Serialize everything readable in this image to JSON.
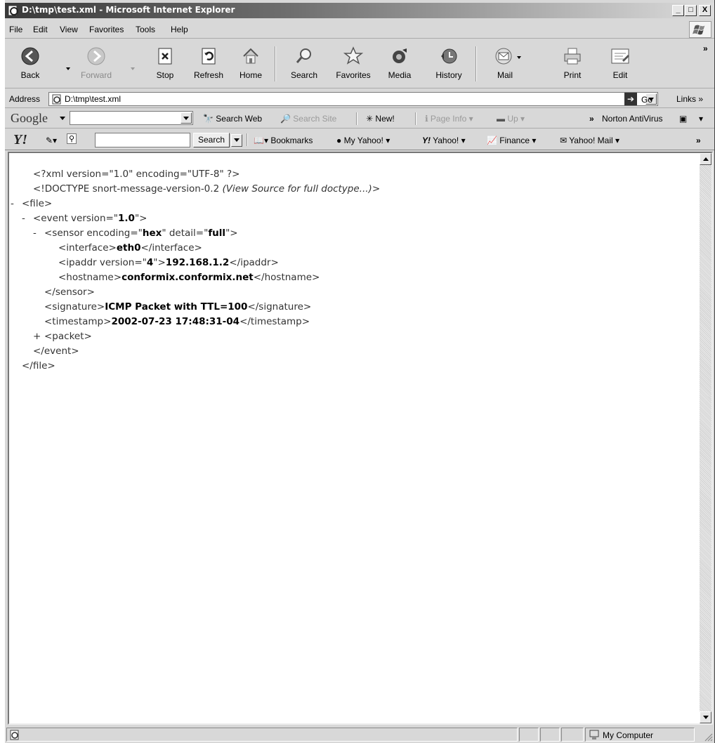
{
  "window": {
    "title": "D:\\tmp\\test.xml - Microsoft Internet Explorer",
    "minimize": "_",
    "maximize": "□",
    "close": "X"
  },
  "menubar": {
    "items": [
      "File",
      "Edit",
      "View",
      "Favorites",
      "Tools",
      "Help"
    ]
  },
  "toolbar": {
    "back": "Back",
    "forward": "Forward",
    "stop": "Stop",
    "refresh": "Refresh",
    "home": "Home",
    "search": "Search",
    "favorites": "Favorites",
    "media": "Media",
    "history": "History",
    "mail": "Mail",
    "print": "Print",
    "edit": "Edit",
    "more": "»"
  },
  "address": {
    "label": "Address",
    "value": "D:\\tmp\\test.xml",
    "go": "Go",
    "links": "Links »"
  },
  "google_bar": {
    "logo": "Google",
    "search_web": "Search Web",
    "search_site": "Search Site",
    "new": "New!",
    "page_info": "Page Info",
    "up": "Up",
    "more": "»",
    "norton": "Norton AntiVirus"
  },
  "yahoo_bar": {
    "logo": "Y!",
    "search_button": "Search",
    "bookmarks": "Bookmarks",
    "my_yahoo": "My Yahoo!",
    "yahoo": "Yahoo!",
    "finance": "Finance",
    "yahoo_mail": "Yahoo! Mail",
    "more": "»"
  },
  "xml": {
    "l1": "<?xml version=\"1.0\" encoding=\"UTF-8\" ?>",
    "l2_a": "<!DOCTYPE snort-message-version-0.2 ",
    "l2_b": "(View Source for full doctype...)",
    "l2_c": ">",
    "file_open": "<file>",
    "event_open_a": "<event version=\"",
    "event_version": "1.0",
    "event_open_b": "\">",
    "sensor_a": "<sensor encoding=\"",
    "sensor_encoding": "hex",
    "sensor_b": "\" detail=\"",
    "sensor_detail": "full",
    "sensor_c": "\">",
    "iface_a": "<interface>",
    "iface_val": "eth0",
    "iface_b": "</interface>",
    "ip_a": "<ipaddr version=\"",
    "ip_version": "4",
    "ip_b": "\">",
    "ip_val": "192.168.1.2",
    "ip_c": "</ipaddr>",
    "host_a": "<hostname>",
    "host_val": "conformix.conformix.net",
    "host_b": "</hostname>",
    "sensor_close": "</sensor>",
    "sig_a": "<signature>",
    "sig_val": "ICMP Packet with TTL=100",
    "sig_b": "</signature>",
    "ts_a": "<timestamp>",
    "ts_val": "2002-07-23 17:48:31-04",
    "ts_b": "</timestamp>",
    "packet": "<packet>",
    "event_close": "</event>",
    "file_close": "</file>",
    "minus": "-",
    "plus": "+"
  },
  "status": {
    "zone": "My Computer"
  }
}
